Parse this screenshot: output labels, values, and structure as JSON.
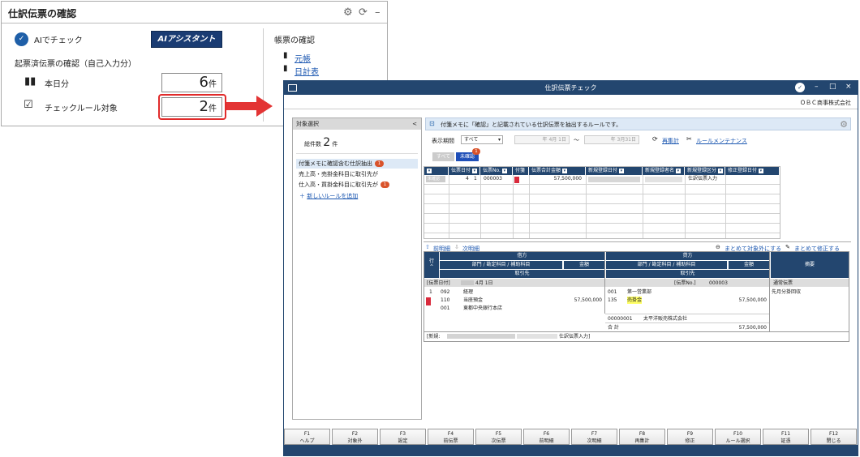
{
  "panel": {
    "title": "仕訳伝票の確認",
    "ai_check_label": "AIでチェック",
    "ai_button_label": "AIアシスタント",
    "section_label": "起票済伝票の確認（自己入力分）",
    "today_label": "本日分",
    "today_count": "6",
    "check_label": "チェックルール対象",
    "check_count": "2",
    "unit": "件",
    "book_section": "帳票の確認",
    "book_links": [
      "元帳",
      "日計表"
    ]
  },
  "window": {
    "title": "仕訳伝票チェック",
    "company": "ＯＢＣ商事株式会社",
    "controls": [
      "–",
      "□",
      "×"
    ],
    "left_panel": {
      "header": "対象選択",
      "total_label": "総件数",
      "total_count": "2",
      "unit": "件",
      "rules": [
        {
          "label": "付箋メモに確認含む仕訳抽出",
          "badge": "1"
        },
        {
          "label": "売上高・売掛金科目に取引先が",
          "badge": ""
        },
        {
          "label": "仕入高・買掛金科目に取引先が",
          "badge": "1"
        }
      ],
      "add_rule": "新しいルールを追加"
    },
    "info_text": "付箋メモに「確認」と記載されている仕訳伝票を抽出するルールです。",
    "period_label": "表示期間",
    "period_value": "すべて",
    "date_from": "年  4月 1日",
    "date_to": "年  3月31日",
    "recalc": "再集計",
    "rule_maint": "ルールメンテナンス",
    "tabs": [
      "すべて",
      "未確認"
    ],
    "tab_badge": "1",
    "table": {
      "headers": [
        "",
        "伝票日付",
        "伝票No.",
        "付箋",
        "伝票合計金額",
        "新規登録日付",
        "新規登録者名",
        "新規登録区分",
        "修正登録日付"
      ],
      "row": {
        "col0": "未確認",
        "month": "4",
        "day": "1",
        "no": "000003",
        "amount": "57,500,000",
        "kubun": "仕訳伝票入力"
      }
    },
    "nav_prev": "前明細",
    "nav_next": "次明細",
    "exclude_all": "まとめて対象外にする",
    "fix_all": "まとめて修正する",
    "journal": {
      "row_label": "行",
      "debit": "借方",
      "credit": "貸方",
      "subject_header": "部門 / 勘定科目 / 補助科目",
      "amount_header": "金額",
      "partner": "取引先",
      "memo": "摘要",
      "date_label": "[伝票日付]",
      "date": "4月 1日",
      "no_label": "[伝票No.]",
      "no": "000003",
      "voucher_type": "通常伝票",
      "line_no": "1",
      "debit_codes": [
        "092",
        "110",
        "001"
      ],
      "debit_names": [
        "経理",
        "当座預金",
        "東都中央銀行本店"
      ],
      "debit_amount": "57,500,000",
      "credit_codes": [
        "001",
        "135"
      ],
      "credit_names": [
        "第一営業部",
        "売掛金"
      ],
      "credit_amount": "57,500,000",
      "memo_text": "先月分掛回収",
      "partner_code": "00000001",
      "partner_name": "太平洋販売株式会社",
      "total_label": "合 計",
      "total_amount": "57,500,000",
      "new_label": "[新規:",
      "new_type": "仕訳伝票入力]"
    },
    "fkeys": [
      {
        "key": "F1",
        "label": "ヘルプ"
      },
      {
        "key": "F2",
        "label": "対象外"
      },
      {
        "key": "F3",
        "label": "設定"
      },
      {
        "key": "F4",
        "label": "前伝票"
      },
      {
        "key": "F5",
        "label": "次伝票"
      },
      {
        "key": "F6",
        "label": "前明細"
      },
      {
        "key": "F7",
        "label": "次明細"
      },
      {
        "key": "F8",
        "label": "再集計"
      },
      {
        "key": "F9",
        "label": "修正"
      },
      {
        "key": "F10",
        "label": "ルール選択"
      },
      {
        "key": "F11",
        "label": "証憑"
      },
      {
        "key": "F12",
        "label": "閉じる"
      }
    ]
  },
  "colors": {
    "navy": "#23466f",
    "red": "#e33434",
    "info_bg": "#dde9f6",
    "highlight": "#ffff66"
  }
}
